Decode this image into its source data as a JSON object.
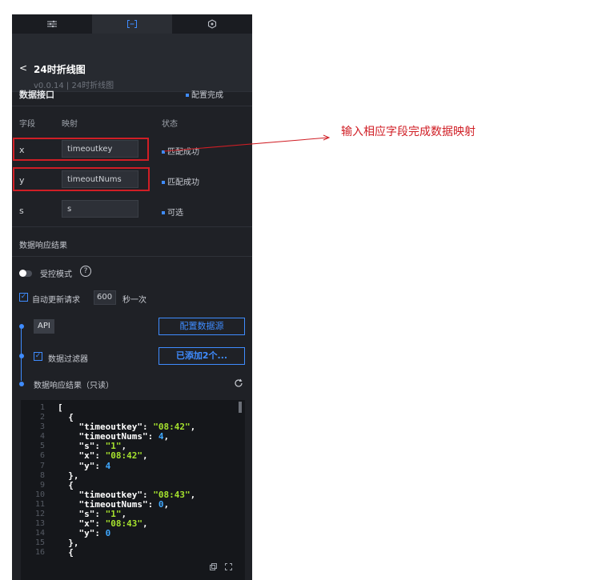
{
  "tabs": [
    {
      "icon": "sliders-icon"
    },
    {
      "icon": "data-bracket-icon"
    },
    {
      "icon": "interaction-icon"
    }
  ],
  "header": {
    "back": "<",
    "title": "24时折线图",
    "subtitle": "v0.0.14 | 24时折线图"
  },
  "data_interface": {
    "title": "数据接口",
    "status": "配置完成"
  },
  "columns": {
    "field": "字段",
    "mapping": "映射",
    "status": "状态"
  },
  "fields": [
    {
      "name": "x",
      "value": "timeoutkey",
      "status": "匹配成功"
    },
    {
      "name": "y",
      "value": "timeoutNums",
      "status": "匹配成功"
    },
    {
      "name": "s",
      "value": "s",
      "status": "可选"
    }
  ],
  "response_title": "数据响应结果",
  "controlled_mode": {
    "label": "受控模式",
    "help": "?"
  },
  "auto_update": {
    "label": "自动更新请求",
    "value": "600",
    "suffix": "秒一次"
  },
  "api": {
    "tag": "API",
    "button": "配置数据源"
  },
  "filter": {
    "label": "数据过滤器",
    "button": "已添加2个..."
  },
  "result_readonly": {
    "label": "数据响应结果（只读）"
  },
  "code_line_numbers": [
    "1",
    "2",
    "3",
    "4",
    "5",
    "6",
    "7",
    "8",
    "9",
    "10",
    "11",
    "12",
    "13",
    "14",
    "15",
    "16"
  ],
  "code_lines": [
    "[",
    "  {",
    "    \"timeoutkey\": \"08:42\",",
    "    \"timeoutNums\": 4,",
    "    \"s\": \"1\",",
    "    \"x\": \"08:42\",",
    "    \"y\": 4",
    "  },",
    "  {",
    "    \"timeoutkey\": \"08:43\",",
    "    \"timeoutNums\": 0,",
    "    \"s\": \"1\",",
    "    \"x\": \"08:43\",",
    "    \"y\": 0",
    "  },",
    "  {"
  ],
  "annotation": "输入相应字段完成数据映射",
  "colors": {
    "accent": "#3f8cff",
    "annotation": "#d01e25",
    "panel_bg": "#1f2126"
  }
}
